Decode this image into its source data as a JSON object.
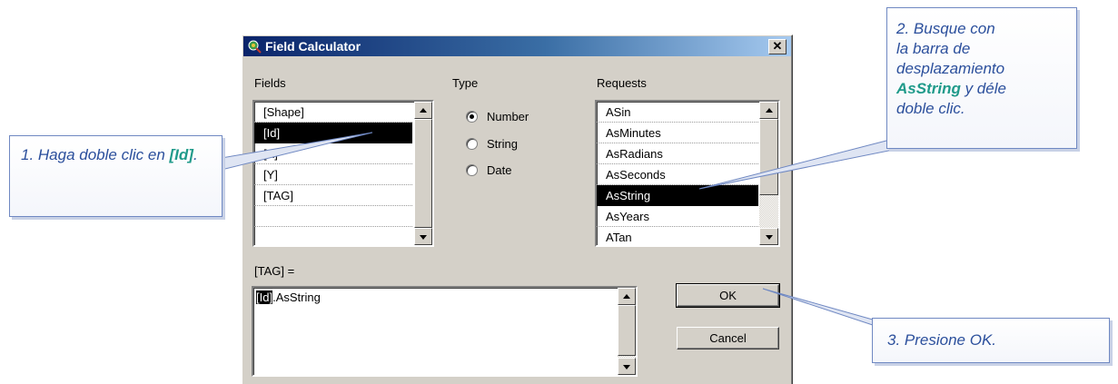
{
  "dialog": {
    "title": "Field Calculator",
    "close_glyph": "✕"
  },
  "fields": {
    "label": "Fields",
    "items": [
      "[Shape]",
      "[Id]",
      "[X]",
      "[Y]",
      "[TAG]",
      "",
      ""
    ],
    "selected_index": 1
  },
  "type": {
    "label": "Type",
    "options": [
      "Number",
      "String",
      "Date"
    ],
    "selected": "Number"
  },
  "requests": {
    "label": "Requests",
    "items": [
      "ASin",
      "AsMinutes",
      "AsRadians",
      "AsSeconds",
      "AsString",
      "AsYears",
      "ATan"
    ],
    "selected_index": 4
  },
  "expression": {
    "label": "[TAG] =",
    "selected_part": "[Id]",
    "rest": ".AsString"
  },
  "buttons": {
    "ok": "OK",
    "cancel": "Cancel"
  },
  "callouts": {
    "step1": {
      "text": "1. Haga doble clic en ",
      "bold": "[Id]",
      "tail": "."
    },
    "step2": {
      "line1": "2. Busque con",
      "line2": "la barra de",
      "line3": "desplazamiento",
      "bold": "AsString",
      "tail": " y déle",
      "line5": "doble clic."
    },
    "step3": {
      "text": "3. Presione OK."
    }
  },
  "colors": {
    "title_gradient_start": "#0a246a",
    "dialog_face": "#d4d0c8",
    "callout_text": "#2b4f9c",
    "callout_bold": "#1f9a8a"
  }
}
